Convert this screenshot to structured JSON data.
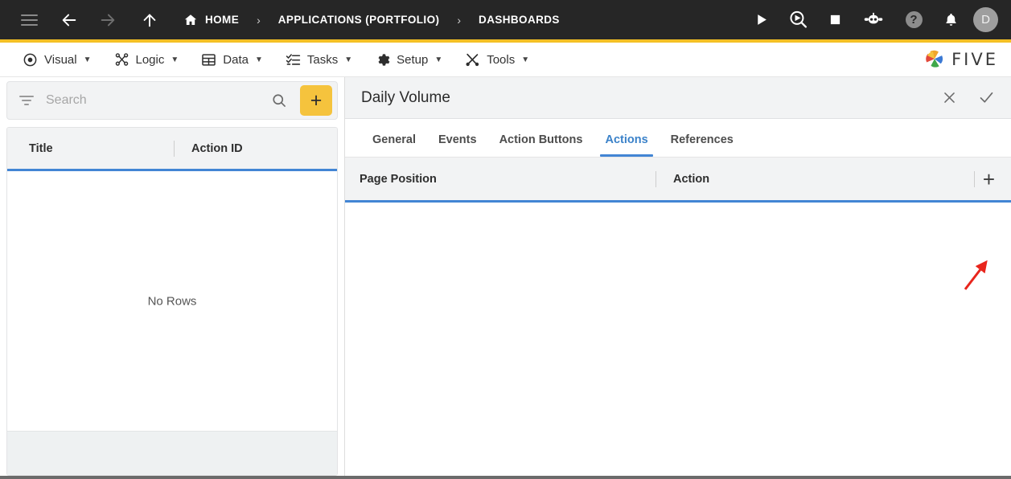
{
  "topbar": {
    "menu_icon": "hamburger-icon",
    "back_icon": "arrow-left-icon",
    "forward_icon": "arrow-right-icon",
    "up_icon": "arrow-up-icon",
    "home_icon": "home-icon",
    "breadcrumbs": [
      {
        "label": "HOME"
      },
      {
        "label": "APPLICATIONS (PORTFOLIO)"
      },
      {
        "label": "DASHBOARDS"
      }
    ],
    "separator": "›",
    "tools": [
      {
        "name": "run-icon",
        "glyph": "▶"
      },
      {
        "name": "preview-icon",
        "glyph": ""
      },
      {
        "name": "stop-icon",
        "glyph": "■"
      },
      {
        "name": "bot-icon",
        "glyph": ""
      },
      {
        "name": "help-icon",
        "glyph": "?"
      },
      {
        "name": "notifications-bell-icon",
        "glyph": "🔔"
      }
    ],
    "avatar_initial": "D"
  },
  "menubar": {
    "items": [
      {
        "label": "Visual",
        "icon": "eye-icon",
        "caret": "▼"
      },
      {
        "label": "Logic",
        "icon": "logic-nodes-icon",
        "caret": "▼"
      },
      {
        "label": "Data",
        "icon": "table-grid-icon",
        "caret": "▼"
      },
      {
        "label": "Tasks",
        "icon": "checklist-icon",
        "caret": "▼"
      },
      {
        "label": "Setup",
        "icon": "gear-icon",
        "caret": "▼"
      },
      {
        "label": "Tools",
        "icon": "tools-icon",
        "caret": "▼"
      }
    ],
    "brand": "FIVE",
    "brand_icon": "five-pinwheel-logo"
  },
  "left_panel": {
    "search": {
      "placeholder": "Search",
      "value": "",
      "filter_icon": "filter-icon",
      "search_icon": "search-icon"
    },
    "add_button_label": "+",
    "grid": {
      "columns": [
        "Title",
        "Action ID"
      ],
      "rows": [],
      "empty_message": "No Rows"
    }
  },
  "right_panel": {
    "title": "Daily Volume",
    "close_label": "✕",
    "confirm_label": "✓",
    "tabs": [
      {
        "label": "General",
        "active": false
      },
      {
        "label": "Events",
        "active": false
      },
      {
        "label": "Action Buttons",
        "active": false
      },
      {
        "label": "Actions",
        "active": true
      },
      {
        "label": "References",
        "active": false
      }
    ],
    "grid": {
      "columns": [
        "Page Position",
        "Action"
      ],
      "rows": [],
      "add_label": "+"
    }
  },
  "annotation": {
    "arrow_color": "#E8251C",
    "points_to": "add-action-row-button"
  },
  "colors": {
    "topbar_bg": "#262626",
    "accent_yellow": "#F4C025",
    "accent_blue": "#4285D4",
    "tab_active": "#3b82c9",
    "header_bg": "#f2f3f4"
  }
}
